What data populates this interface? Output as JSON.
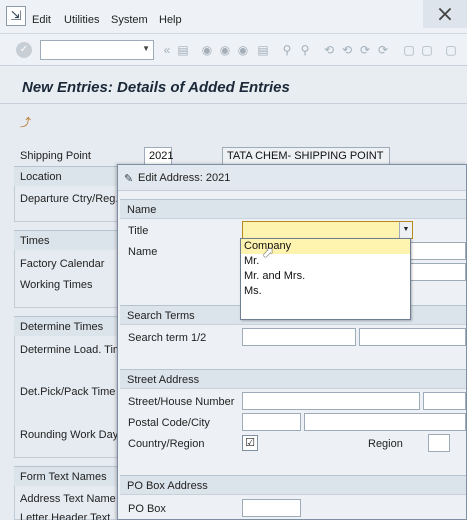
{
  "menu": {
    "items": [
      "Edit",
      "Utilities",
      "System",
      "Help"
    ]
  },
  "page": {
    "title": "New Entries: Details of Added Entries"
  },
  "background": {
    "shipping_point_label": "Shipping Point",
    "shipping_point_value": "2021",
    "shipping_point_desc": "TATA CHEM- SHIPPING POINT",
    "sections": {
      "location": "Location",
      "times": "Times",
      "determine_times": "Determine Times",
      "form_text_names": "Form Text Names"
    },
    "labels": {
      "departure_ctry": "Departure Ctry/Reg.",
      "factory_calendar": "Factory Calendar",
      "working_times": "Working Times",
      "determine_load_time": "Determine Load. Time",
      "det_pick_pack_time": "Det.Pick/Pack Time",
      "rounding_work_days": "Rounding Work Days",
      "address_text_name": "Address Text Name",
      "letter_header_text": "Letter Header Text"
    }
  },
  "dialog": {
    "title": "Edit Address:  2021",
    "name_section": "Name",
    "title_label": "Title",
    "title_value": "",
    "name_label": "Name",
    "search_section": "Search Terms",
    "search_label": "Search term 1/2",
    "street_section": "Street Address",
    "street_label": "Street/House Number",
    "postal_label": "Postal Code/City",
    "country_label": "Country/Region",
    "country_value": "",
    "region_label": "Region",
    "pobox_section": "PO Box Address",
    "pobox_label": "PO Box"
  },
  "title_dropdown": {
    "options": [
      "Company",
      "Mr.",
      "Mr. and Mrs.",
      "Ms."
    ],
    "highlighted": "Company"
  }
}
